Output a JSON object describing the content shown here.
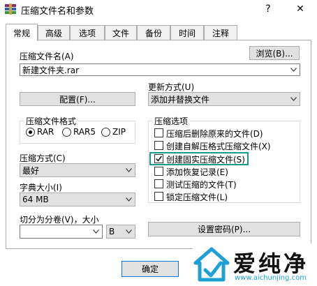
{
  "window": {
    "title": "压缩文件名和参数",
    "help_symbol": "?",
    "close_symbol": "✕"
  },
  "tabs": [
    {
      "label": "常规",
      "active": true
    },
    {
      "label": "高级"
    },
    {
      "label": "选项"
    },
    {
      "label": "文件"
    },
    {
      "label": "备份"
    },
    {
      "label": "时间"
    },
    {
      "label": "注释"
    }
  ],
  "archive_name": {
    "label": "压缩文件名(A)",
    "browse_label": "浏览(B)...",
    "value": "新建文件夹.rar"
  },
  "profile_label": "配置(F)...",
  "update_mode": {
    "label": "更新方式(U)",
    "value": "添加并替换文件"
  },
  "archive_format": {
    "legend": "压缩文件格式",
    "options": [
      {
        "label": "RAR",
        "selected": true
      },
      {
        "label": "RAR5",
        "selected": false
      },
      {
        "label": "ZIP",
        "selected": false
      }
    ]
  },
  "compression_method": {
    "label": "压缩方式(C)",
    "value": "最好"
  },
  "dictionary_size": {
    "label": "字典大小(I)",
    "value": "64 MB"
  },
  "split": {
    "label": "切分为分卷(V)，大小",
    "value": "",
    "unit": "B"
  },
  "options": {
    "legend": "压缩选项",
    "items": [
      {
        "label": "压缩后删除原来的文件(D)",
        "checked": false
      },
      {
        "label": "创建自解压格式压缩文件(X)",
        "checked": false
      },
      {
        "label": "创建固实压缩文件(S)",
        "checked": true
      },
      {
        "label": "添加恢复记录(E)",
        "checked": false
      },
      {
        "label": "测试压缩的文件(T)",
        "checked": false
      },
      {
        "label": "锁定压缩文件(L)",
        "checked": false
      }
    ]
  },
  "set_password_label": "设置密码(P)...",
  "ok_label": "确定",
  "watermark": {
    "brand": "爱纯净",
    "url": "www.aichunjing.com"
  },
  "colors": {
    "highlight": "#1a9a8c",
    "panel_border": "#adadad",
    "button_face": "#e1e1e1"
  }
}
